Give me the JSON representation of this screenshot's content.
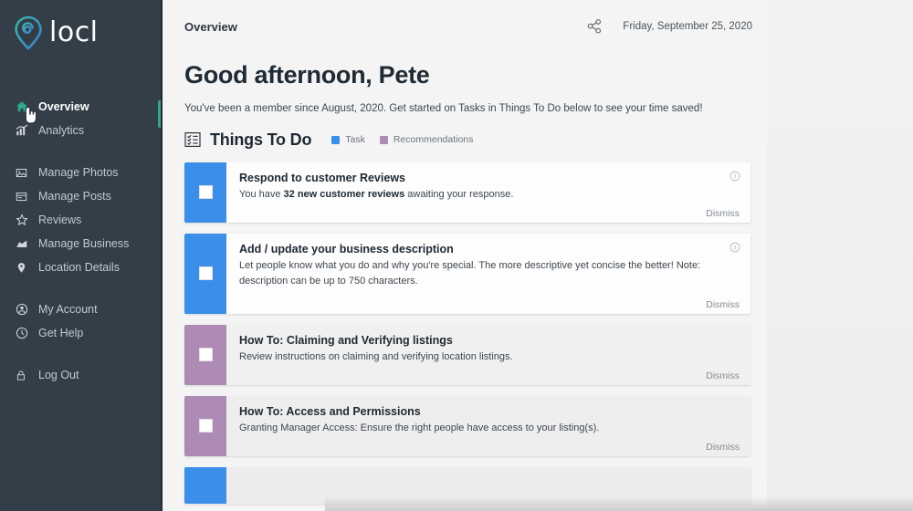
{
  "brand": {
    "name": "locl",
    "logo_icon": "locl-pin-logo",
    "logo_gradient_from": "#3bb5a6",
    "logo_gradient_to": "#3f7fd4"
  },
  "sidebar": {
    "active_color": "#3aa58a",
    "background": "#333e48",
    "groups": [
      {
        "items": [
          {
            "label": "Overview",
            "icon": "home-icon",
            "active": true
          },
          {
            "label": "Analytics",
            "icon": "analytics-icon",
            "active": false
          }
        ]
      },
      {
        "items": [
          {
            "label": "Manage Photos",
            "icon": "photo-icon",
            "active": false
          },
          {
            "label": "Manage Posts",
            "icon": "post-icon",
            "active": false
          },
          {
            "label": "Reviews",
            "icon": "star-icon",
            "active": false
          },
          {
            "label": "Manage Business",
            "icon": "business-icon",
            "active": false
          },
          {
            "label": "Location Details",
            "icon": "map-pin-icon",
            "active": false
          }
        ]
      },
      {
        "items": [
          {
            "label": "My Account",
            "icon": "user-icon",
            "active": false
          },
          {
            "label": "Get Help",
            "icon": "help-icon",
            "active": false
          }
        ]
      },
      {
        "items": [
          {
            "label": "Log Out",
            "icon": "lock-icon",
            "active": false
          }
        ]
      }
    ]
  },
  "topbar": {
    "title": "Overview",
    "share_icon": "share-icon",
    "date": "Friday, September 25, 2020"
  },
  "greeting": {
    "heading": "Good afternoon, Pete",
    "subtext": "You've been a member since August, 2020. Get started on Tasks in Things To Do below to see your time saved!"
  },
  "things_to_do": {
    "icon": "checklist-icon",
    "title": "Things To Do",
    "legend": [
      {
        "label": "Task",
        "color": "#3b8fe8"
      },
      {
        "label": "Recommendations",
        "color": "#ad8bb5"
      }
    ],
    "dismiss_label": "Dismiss",
    "info_icon": "info-icon",
    "cards": [
      {
        "type": "Task",
        "accent": "#3b8fe8",
        "title": "Respond to customer Reviews",
        "desc_pre": "You have ",
        "desc_bold": "32 new customer reviews",
        "desc_post": " awaiting your response.",
        "has_info": true
      },
      {
        "type": "Task",
        "accent": "#3b8fe8",
        "title": "Add / update your business description",
        "desc_pre": "Let people know what you do and why you're special. The more descriptive yet concise the better! Note: description can be up to 750 characters.",
        "desc_bold": "",
        "desc_post": "",
        "has_info": true
      },
      {
        "type": "Recommendations",
        "accent": "#ad8bb5",
        "title": "How To: Claiming and Verifying listings",
        "desc_pre": "Review instructions on claiming and verifying location listings.",
        "desc_bold": "",
        "desc_post": "",
        "has_info": false
      },
      {
        "type": "Recommendations",
        "accent": "#ad8bb5",
        "title": "How To: Access and Permissions",
        "desc_pre": "Granting Manager Access: Ensure the right people have access to your listing(s).",
        "desc_bold": "",
        "desc_post": "",
        "has_info": false
      },
      {
        "type": "Task",
        "accent": "#3b8fe8",
        "title": "",
        "desc_pre": "",
        "desc_bold": "",
        "desc_post": "",
        "has_info": false
      }
    ]
  }
}
